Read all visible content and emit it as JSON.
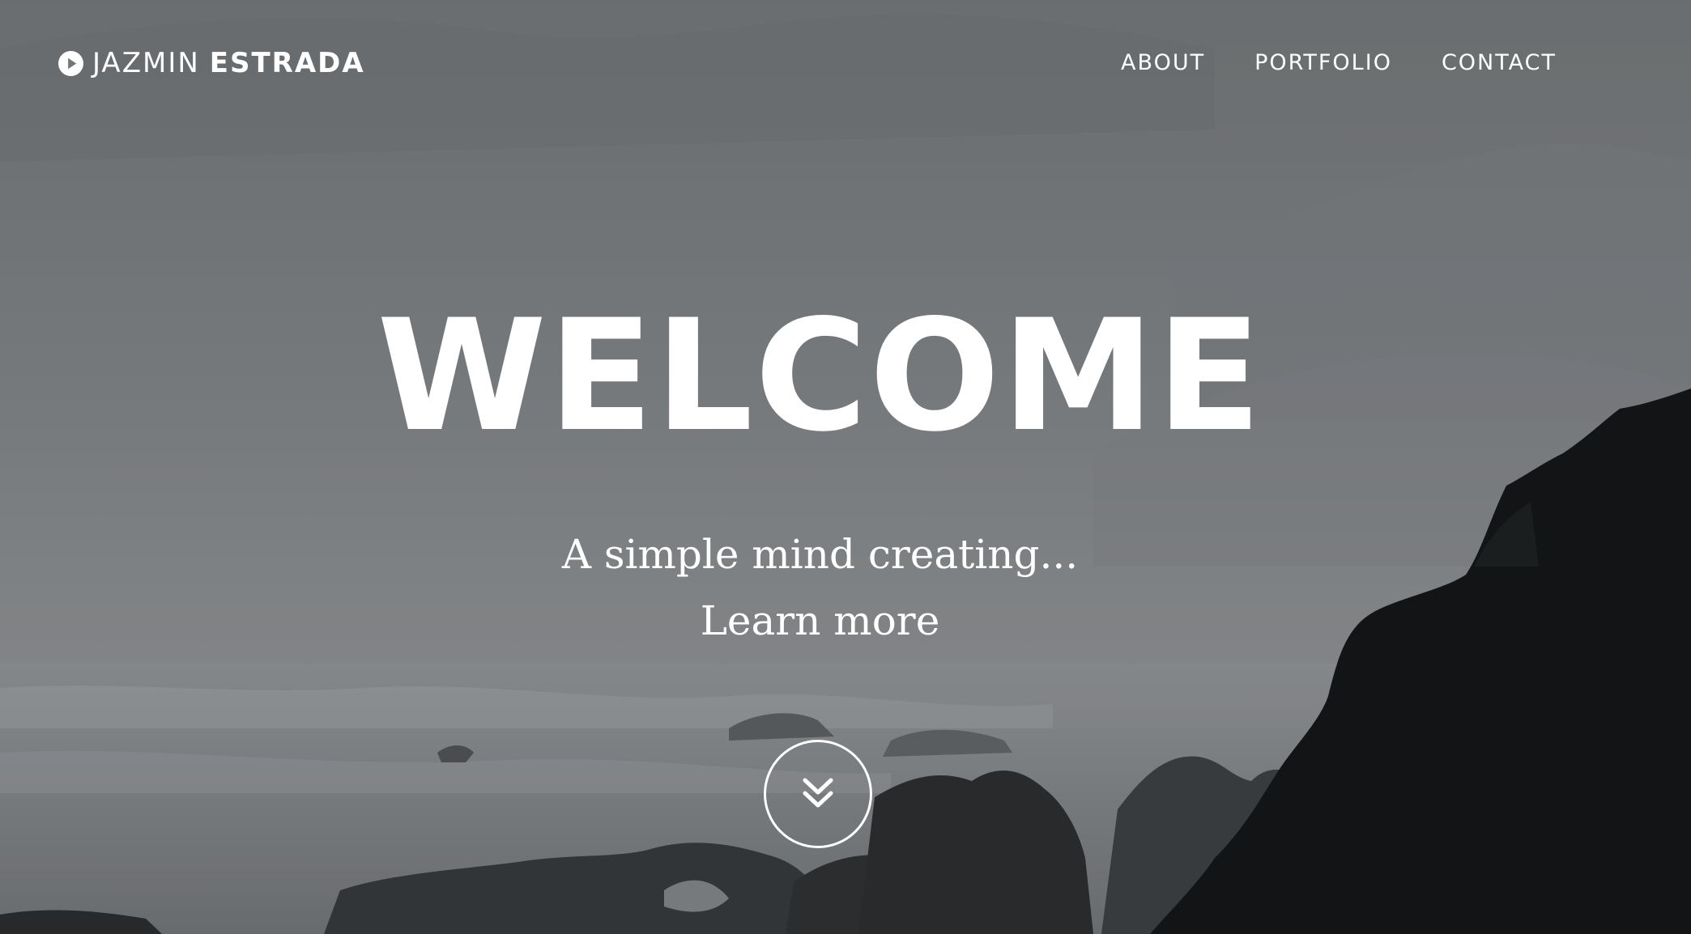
{
  "brand": {
    "first_name": "JAZMIN",
    "last_name": "ESTRADA",
    "icon": "play-circle-icon"
  },
  "nav": {
    "items": [
      {
        "label": "ABOUT"
      },
      {
        "label": "PORTFOLIO"
      },
      {
        "label": "CONTACT"
      }
    ]
  },
  "hero": {
    "headline": "WELCOME",
    "tagline": "A simple mind creating...",
    "learn_more": "Learn more",
    "scroll_icon": "double-chevron-down-icon"
  },
  "colors": {
    "text": "#ffffff",
    "overlay": "#777a7d",
    "cliff": "#141617"
  }
}
